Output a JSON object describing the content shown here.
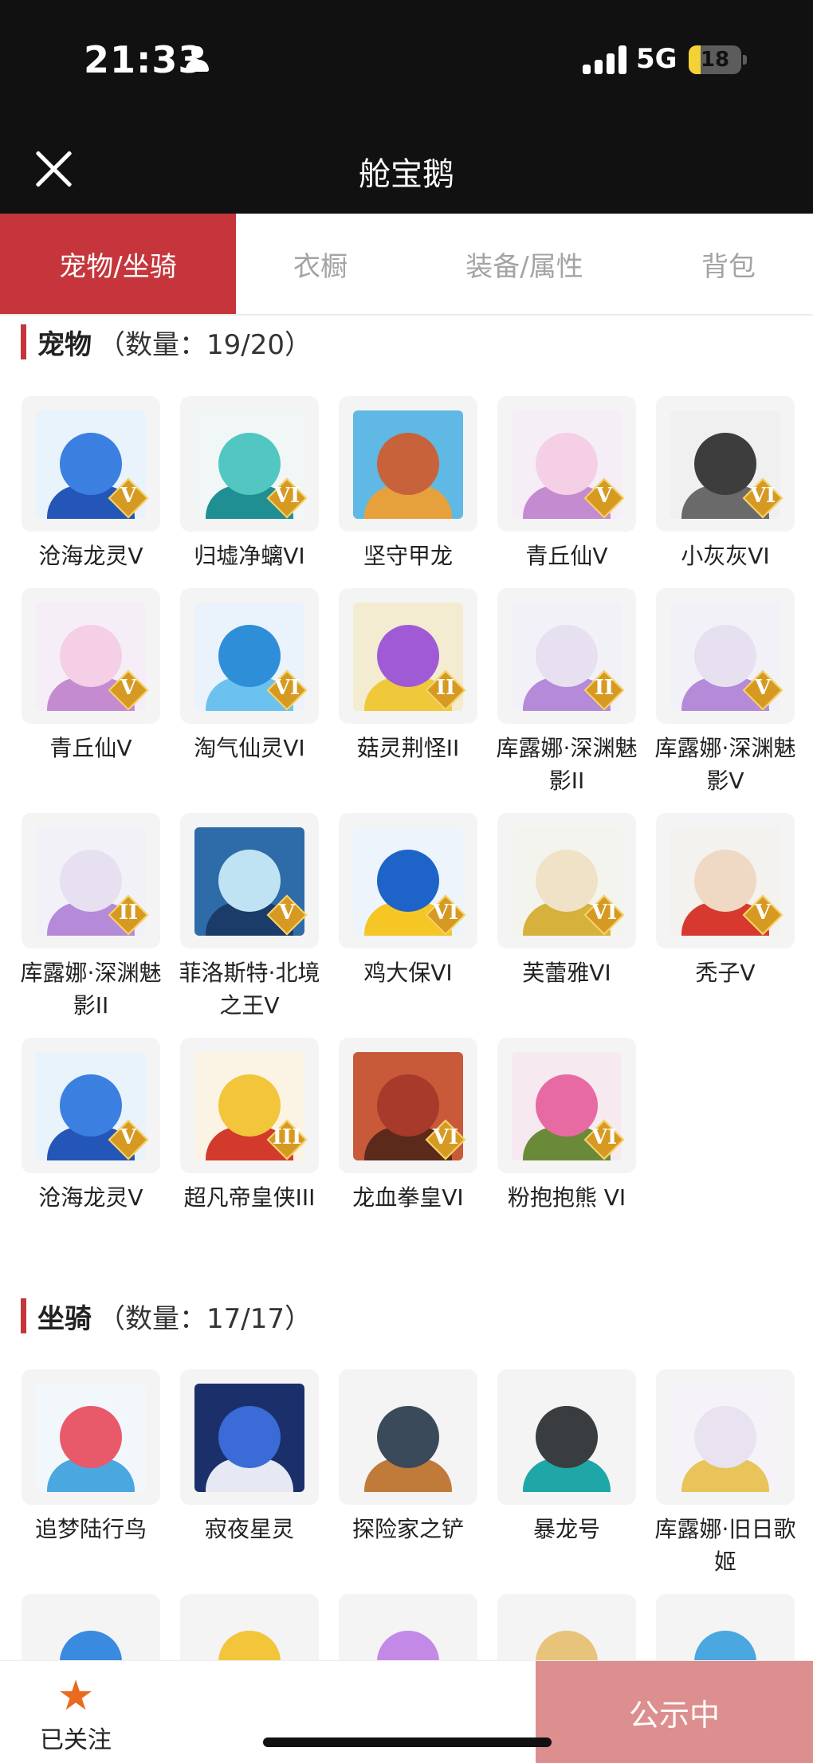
{
  "status_bar": {
    "time": "21:33",
    "network": "5G",
    "battery_level": "18"
  },
  "nav": {
    "title": "舱宝鹅"
  },
  "tabs": [
    {
      "label": "宠物/坐骑",
      "active": true
    },
    {
      "label": "衣橱",
      "active": false
    },
    {
      "label": "装备/属性",
      "active": false
    },
    {
      "label": "背包",
      "active": false
    }
  ],
  "pets_section": {
    "title": "宠物",
    "count": "（数量：19/20）"
  },
  "pets": [
    {
      "name": "沧海龙灵V",
      "badge": "V",
      "colors": [
        "#e9f3fb",
        "#3b7fe0",
        "#2456b8"
      ]
    },
    {
      "name": "归墟净螭VI",
      "badge": "VI",
      "colors": [
        "#f1f7f6",
        "#52c7c2",
        "#1f8f93"
      ]
    },
    {
      "name": "坚守甲龙",
      "badge": "",
      "colors": [
        "#5fb9e4",
        "#c8623b",
        "#e7a13c"
      ]
    },
    {
      "name": "青丘仙V",
      "badge": "V",
      "colors": [
        "#f6eef6",
        "#f4cfe6",
        "#c58bd1"
      ]
    },
    {
      "name": "小灰灰VI",
      "badge": "VI",
      "colors": [
        "#f0f0f0",
        "#3d3d3d",
        "#6a6a6a"
      ]
    },
    {
      "name": "青丘仙V",
      "badge": "V",
      "colors": [
        "#f6eef6",
        "#f4cfe6",
        "#c58bd1"
      ]
    },
    {
      "name": "淘气仙灵VI",
      "badge": "VI",
      "colors": [
        "#eaf3fb",
        "#2f8ed8",
        "#6cc2ef"
      ]
    },
    {
      "name": "菇灵荆怪II",
      "badge": "II",
      "colors": [
        "#f3ecd0",
        "#a15ad6",
        "#f0c93b"
      ]
    },
    {
      "name": "库露娜·深渊魅影II",
      "badge": "II",
      "colors": [
        "#f3f1f8",
        "#e7e0f0",
        "#b48ad9"
      ]
    },
    {
      "name": "库露娜·深渊魅影V",
      "badge": "V",
      "colors": [
        "#f3f1f8",
        "#e7e0f0",
        "#b48ad9"
      ]
    },
    {
      "name": "库露娜·深渊魅影II",
      "badge": "II",
      "colors": [
        "#f3f1f8",
        "#e7e0f0",
        "#b48ad9"
      ]
    },
    {
      "name": "菲洛斯特·北境之王V",
      "badge": "V",
      "colors": [
        "#2d6ca8",
        "#bfe3f3",
        "#1b3c68"
      ]
    },
    {
      "name": "鸡大保VI",
      "badge": "VI",
      "colors": [
        "#eef4fb",
        "#1d63c8",
        "#f5c624"
      ]
    },
    {
      "name": "芙蕾雅VI",
      "badge": "VI",
      "colors": [
        "#f4f4ef",
        "#f0e2c6",
        "#d6b13b"
      ]
    },
    {
      "name": "秃子V",
      "badge": "V",
      "colors": [
        "#f4f2ef",
        "#efd8c4",
        "#d8392f"
      ]
    },
    {
      "name": "沧海龙灵V",
      "badge": "V",
      "colors": [
        "#e9f3fb",
        "#3b7fe0",
        "#2456b8"
      ]
    },
    {
      "name": "超凡帝皇侠III",
      "badge": "III",
      "colors": [
        "#fbf4e4",
        "#f2c53a",
        "#d23a2c"
      ]
    },
    {
      "name": "龙血拳皇VI",
      "badge": "VI",
      "colors": [
        "#c85a3a",
        "#a73a2a",
        "#5b2a1a"
      ]
    },
    {
      "name": "粉抱抱熊 VI",
      "badge": "VI",
      "colors": [
        "#f6eaf0",
        "#e86aa3",
        "#6a8a3a"
      ]
    }
  ],
  "mounts_section": {
    "title": "坐骑",
    "count": "（数量：17/17）"
  },
  "mounts": [
    {
      "name": "追梦陆行鸟",
      "colors": [
        "#f2f7fb",
        "#e85a6a",
        "#4aa7e0"
      ]
    },
    {
      "name": "寂夜星灵",
      "colors": [
        "#1b2f6a",
        "#3a6bd6",
        "#e6e9f4"
      ]
    },
    {
      "name": "探险家之铲",
      "colors": [
        "#f4f4f4",
        "#3a4a5a",
        "#c07a3a"
      ]
    },
    {
      "name": "暴龙号",
      "colors": [
        "#f4f4f4",
        "#3a3d40",
        "#1fa7a7"
      ]
    },
    {
      "name": "库露娜·旧日歌姬",
      "colors": [
        "#f5f3f8",
        "#e9e2f1",
        "#e9c45a"
      ]
    },
    {
      "name": "",
      "colors": [
        "#f4f4f4",
        "#3a8ae0",
        "#9ad0f4"
      ]
    },
    {
      "name": "",
      "colors": [
        "#f4f4f4",
        "#f2c53a",
        "#3a3a3a"
      ]
    },
    {
      "name": "",
      "colors": [
        "#f4f4f4",
        "#c28ae6",
        "#f08ac8"
      ]
    },
    {
      "name": "",
      "colors": [
        "#f4f4f4",
        "#e8c37a",
        "#b98a4a"
      ]
    },
    {
      "name": "",
      "colors": [
        "#f4f4f4",
        "#4aa7e0",
        "#e8e8e8"
      ]
    }
  ],
  "bottom_bar": {
    "follow_label": "已关注",
    "publish_label": "公示中"
  }
}
